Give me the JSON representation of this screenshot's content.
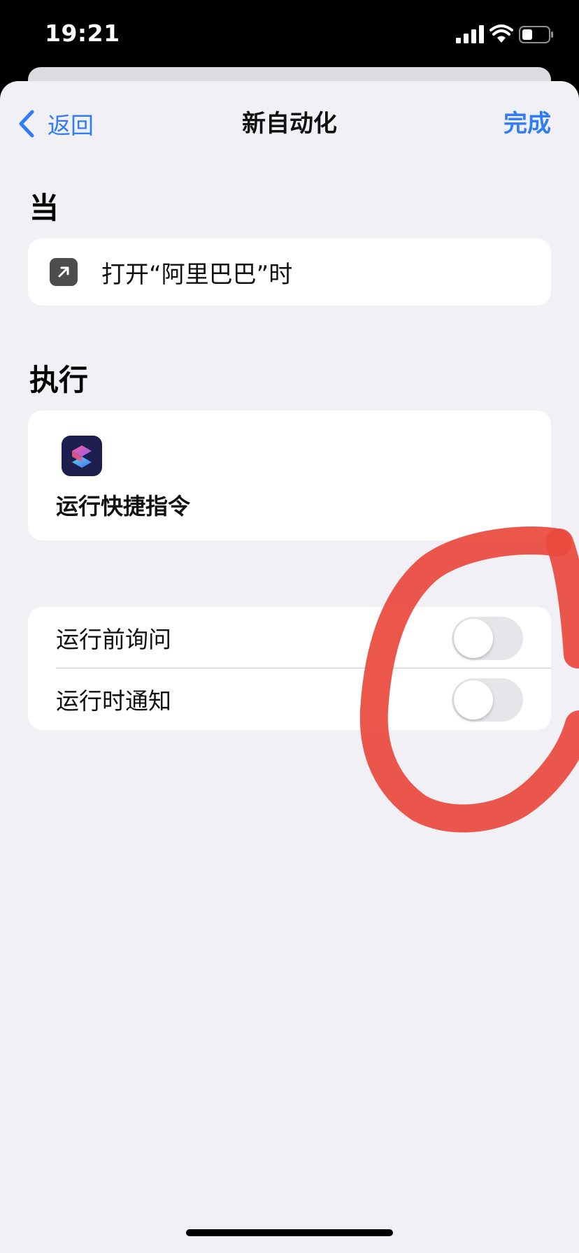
{
  "status_bar": {
    "time": "19:21",
    "icons": [
      "signal-icon",
      "wifi-icon",
      "battery-icon"
    ]
  },
  "nav": {
    "back_label": "返回",
    "title": "新自动化",
    "done_label": "完成"
  },
  "when_section": {
    "heading": "当",
    "trigger_text": "打开“阿里巴巴”时",
    "trigger_icon": "open-app-icon"
  },
  "do_section": {
    "heading": "执行",
    "action_label": "运行快捷指令",
    "action_icon": "shortcuts-icon"
  },
  "options": [
    {
      "label": "运行前询问",
      "on": false
    },
    {
      "label": "运行时通知",
      "on": false
    }
  ],
  "colors": {
    "accent": "#2f7cf6",
    "background": "#f0f0f5",
    "card": "#ffffff",
    "annotation": "#eb4a3e"
  }
}
